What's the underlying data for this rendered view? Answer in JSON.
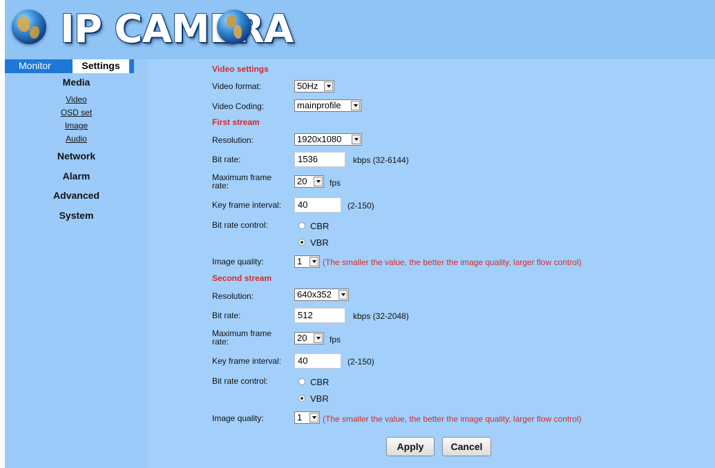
{
  "header": {
    "logo_text": "IP CAMERA"
  },
  "tabs": {
    "monitor": "Monitor",
    "settings": "Settings"
  },
  "menu": {
    "media": "Media",
    "media_items": [
      "Video",
      "OSD set",
      "Image",
      "Audio"
    ],
    "network": "Network",
    "alarm": "Alarm",
    "advanced": "Advanced",
    "system": "System"
  },
  "video_settings": {
    "title": "Video settings",
    "format_label": "Video format:",
    "format_value": "50Hz",
    "coding_label": "Video Coding:",
    "coding_value": "mainprofile"
  },
  "first_stream": {
    "title": "First stream",
    "resolution_label": "Resolution:",
    "resolution_value": "1920x1080",
    "bitrate_label": "Bit rate:",
    "bitrate_value": "1536",
    "bitrate_hint": "kbps (32-6144)",
    "maxfps_label_1": "Maximum frame",
    "maxfps_label_2": "rate:",
    "maxfps_value": "20",
    "maxfps_unit": "fps",
    "keyframe_label": "Key frame interval:",
    "keyframe_value": "40",
    "keyframe_hint": "(2-150)",
    "control_label": "Bit rate control:",
    "cbr": "CBR",
    "vbr": "VBR",
    "control_selected": "VBR",
    "quality_label": "Image quality:",
    "quality_value": "1",
    "quality_note": "(The smaller the value, the better the image quality, larger flow control)"
  },
  "second_stream": {
    "title": "Second stream",
    "resolution_label": "Resolution:",
    "resolution_value": "640x352",
    "bitrate_label": "Bit rate:",
    "bitrate_value": "512",
    "bitrate_hint": "kbps (32-2048)",
    "maxfps_label_1": "Maximum frame",
    "maxfps_label_2": "rate:",
    "maxfps_value": "20",
    "maxfps_unit": "fps",
    "keyframe_label": "Key frame interval:",
    "keyframe_value": "40",
    "keyframe_hint": "(2-150)",
    "control_label": "Bit rate control:",
    "cbr": "CBR",
    "vbr": "VBR",
    "control_selected": "VBR",
    "quality_label": "Image quality:",
    "quality_value": "1",
    "quality_note": "(The smaller the value, the better the image quality, larger flow control)"
  },
  "buttons": {
    "apply": "Apply",
    "cancel": "Cancel"
  },
  "colors": {
    "header": "#8fc4f5",
    "sidebar": "#9ccbfa",
    "content": "#a3d0fb",
    "accent_tab": "#1e78d8",
    "section_red": "#d42a2a"
  }
}
